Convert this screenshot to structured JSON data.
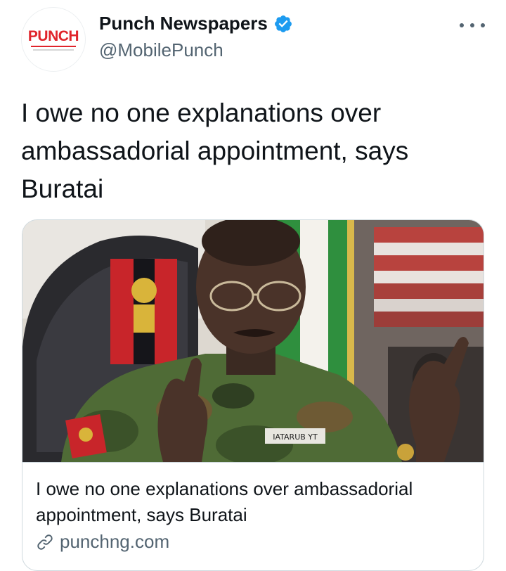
{
  "author": {
    "display_name": "Punch Newspapers",
    "handle": "@MobilePunch",
    "avatar_text": "PUNCH",
    "verified": true
  },
  "tweet": {
    "text": "I owe no one explanations over ambassadorial appointment, says Buratai"
  },
  "card": {
    "title": "I owe no one explanations over ambassadorial appointment, says Buratai",
    "domain": "punchng.com",
    "image_name_tag": "IATARUB YT"
  },
  "colors": {
    "brand_red": "#e0242b",
    "verified_blue": "#1d9bf0",
    "secondary_text": "#536471",
    "border": "#cfd9de"
  },
  "icons": {
    "more": "more-dots-icon",
    "verified": "verified-badge-icon",
    "link": "link-icon"
  }
}
